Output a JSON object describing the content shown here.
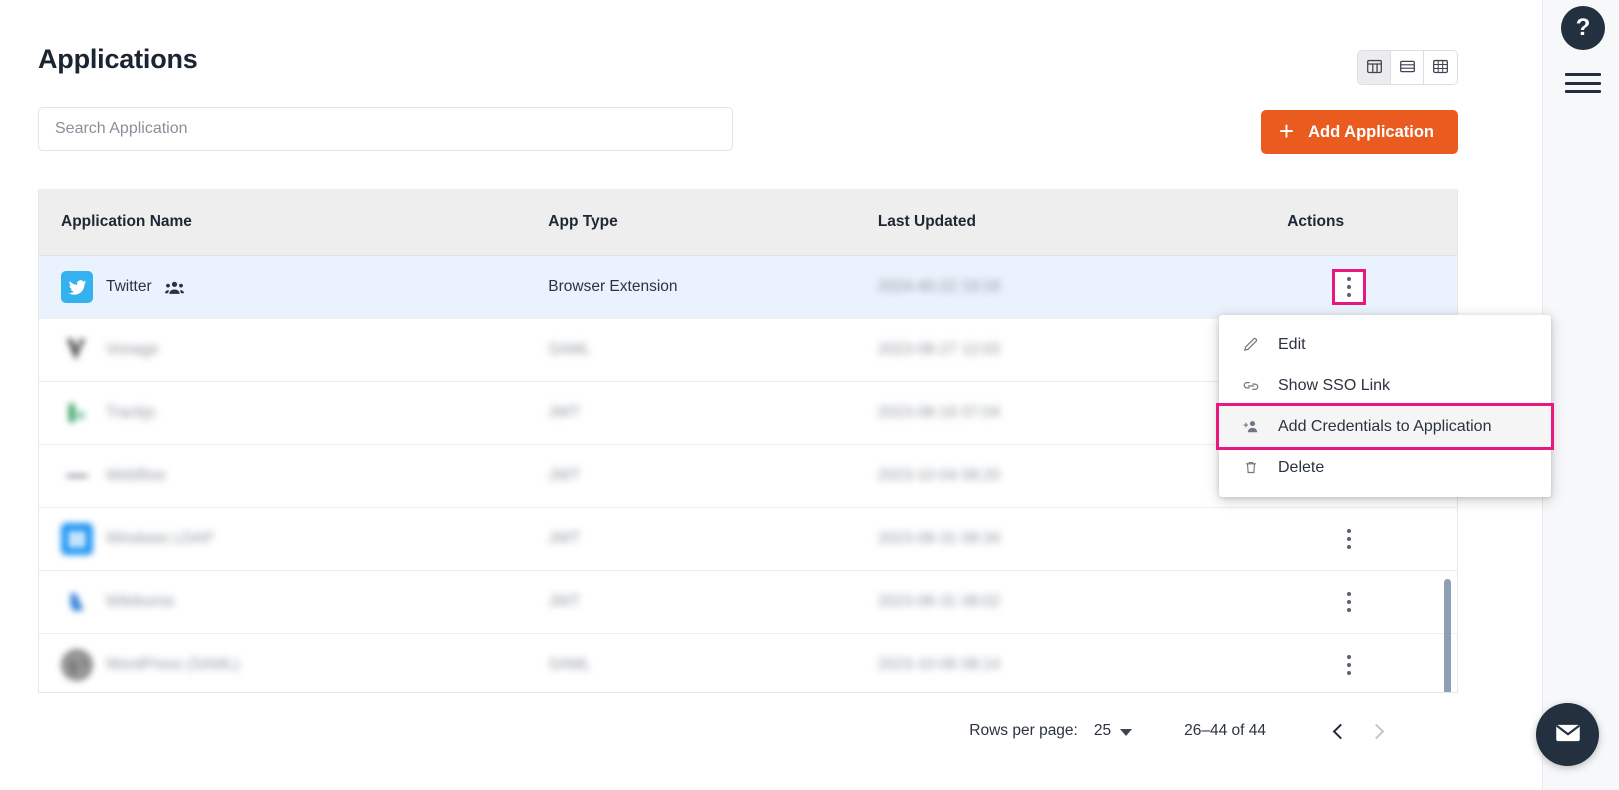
{
  "page": {
    "title": "Applications"
  },
  "search": {
    "placeholder": "Search Application",
    "value": ""
  },
  "toolbar": {
    "add_label": "Add Application",
    "add_icon": "plus-icon",
    "accent_color": "#ea5b1f",
    "views": [
      {
        "name": "column-view",
        "icon": "table-columns-icon",
        "active": true
      },
      {
        "name": "list-view",
        "icon": "list-rows-icon",
        "active": false
      },
      {
        "name": "grid-view",
        "icon": "grid-icon",
        "active": false
      }
    ]
  },
  "right_rail": {
    "help_icon": "question-mark-icon",
    "help_label": "?",
    "menu_icon": "hamburger-icon",
    "mail_icon": "envelope-icon"
  },
  "table": {
    "columns": [
      "Application Name",
      "App Type",
      "Last Updated",
      "Actions"
    ],
    "rows": [
      {
        "name": "Twitter",
        "icon": "twitter-icon",
        "shared_icon": "people-group-icon",
        "type": "Browser Extension",
        "updated": "2024-40-22 19:18",
        "updated_blurred": true,
        "name_blurred": false,
        "selected": true,
        "menu_open": true
      },
      {
        "name": "Vonage",
        "icon": "vonage-icon",
        "type": "SAML",
        "updated": "2023-08-27 12:03",
        "updated_blurred": true,
        "name_blurred": true,
        "selected": false,
        "menu_open": false
      },
      {
        "name": "Trackjs",
        "icon": "trackjs-icon",
        "type": "JWT",
        "updated": "2023-08-16 07:04",
        "updated_blurred": true,
        "name_blurred": true,
        "selected": false,
        "menu_open": false
      },
      {
        "name": "Webflow",
        "icon": "webflow-icon",
        "type": "JWT",
        "updated": "2023-10-04 08:20",
        "updated_blurred": true,
        "name_blurred": true,
        "selected": false,
        "menu_open": false
      },
      {
        "name": "Windows LDAP",
        "icon": "windows-icon",
        "type": "JWT",
        "updated": "2023-08-31 08:34",
        "updated_blurred": true,
        "name_blurred": true,
        "selected": false,
        "menu_open": false
      },
      {
        "name": "Wikibuma",
        "icon": "wiki-icon",
        "type": "JWT",
        "updated": "2023-08-31 08:02",
        "updated_blurred": true,
        "name_blurred": true,
        "selected": false,
        "menu_open": false
      },
      {
        "name": "WordPress (SAML)",
        "icon": "wordpress-icon",
        "type": "SAML",
        "updated": "2023-10-06 08:14",
        "updated_blurred": true,
        "name_blurred": true,
        "selected": false,
        "menu_open": false
      }
    ]
  },
  "context_menu": {
    "items": [
      {
        "label": "Edit",
        "icon": "pencil-icon",
        "active": false
      },
      {
        "label": "Show SSO Link",
        "icon": "link-icon",
        "active": false
      },
      {
        "label": "Add Credentials to Application",
        "icon": "person-add-icon",
        "active": true
      },
      {
        "label": "Delete",
        "icon": "trash-icon",
        "active": false
      }
    ],
    "highlight_color": "#e8187f"
  },
  "pagination": {
    "rows_per_page_label": "Rows per page:",
    "rows_per_page_value": "25",
    "range_label": "26–44 of 44",
    "prev_icon": "chevron-left-icon",
    "next_icon": "chevron-right-icon",
    "prev_enabled": true,
    "next_enabled": false
  }
}
